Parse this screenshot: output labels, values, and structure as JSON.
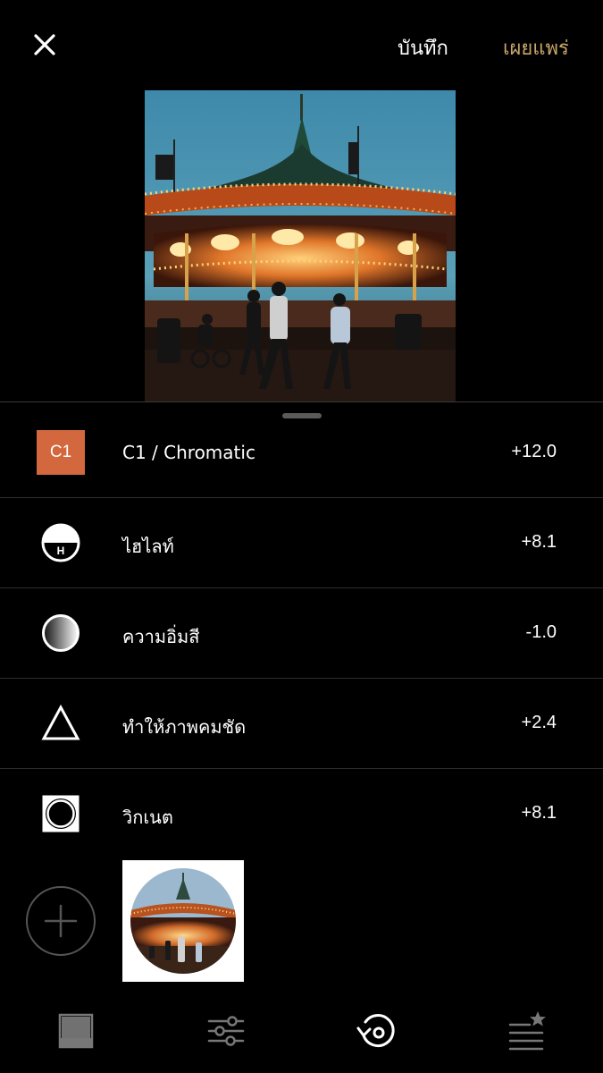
{
  "header": {
    "save_label": "บันทึก",
    "publish_label": "เผยแพร่",
    "publish_color": "#c9a66b"
  },
  "adjustments": [
    {
      "icon": "c1-preset-badge",
      "badge_text": "C1",
      "badge_color": "#d3673d",
      "label": "C1 / Chromatic",
      "value": "+12.0"
    },
    {
      "icon": "highlights-icon",
      "badge_text": "H",
      "label": "ไฮไลท์",
      "value": "+8.1"
    },
    {
      "icon": "saturation-icon",
      "label": "ความอิ่มสี",
      "value": "-1.0"
    },
    {
      "icon": "sharpen-icon",
      "label": "ทำให้ภาพคมชัด",
      "value": "+2.4"
    },
    {
      "icon": "vignette-icon",
      "label": "วิกเนต",
      "value": "+8.1"
    }
  ],
  "tabs": [
    {
      "icon": "presets-icon",
      "active": false
    },
    {
      "icon": "tools-sliders-icon",
      "active": false
    },
    {
      "icon": "history-icon",
      "active": true
    },
    {
      "icon": "recipes-icon",
      "active": false
    }
  ]
}
